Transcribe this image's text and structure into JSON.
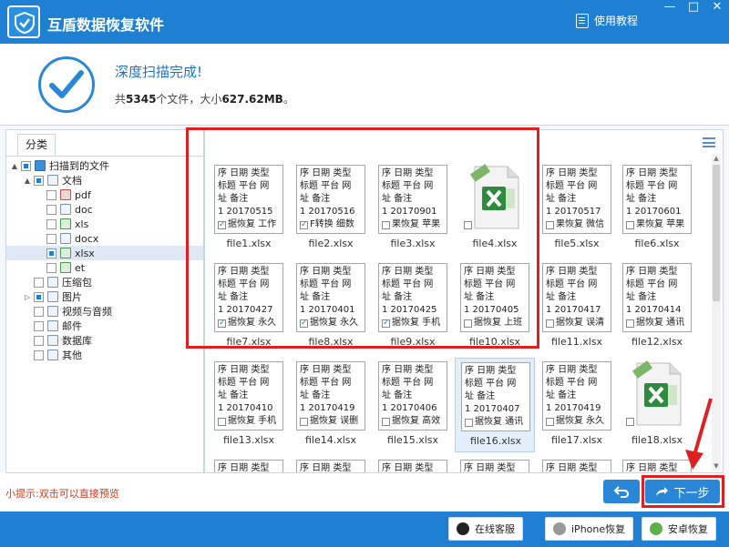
{
  "app": {
    "title": "互盾数据恢复软件",
    "tutorial_label": "使用教程",
    "window_buttons": [
      "—",
      "□",
      "✕"
    ]
  },
  "status": {
    "title": "深度扫描完成!",
    "prefix": "共",
    "file_count": "5345",
    "mid": "个文件，大小",
    "size": "627.62MB",
    "suffix": "。"
  },
  "left_panel": {
    "tab_label": "分类",
    "tree": [
      {
        "label": "扫描到的文件",
        "toggle": "▲",
        "icon": "folder",
        "check": "partial"
      },
      {
        "label": "文档",
        "toggle": "▲",
        "icon": "doc",
        "check": "partial"
      },
      {
        "label": "pdf",
        "toggle": "",
        "icon": "pdf",
        "check": "none"
      },
      {
        "label": "doc",
        "toggle": "",
        "icon": "doc",
        "check": "none"
      },
      {
        "label": "xls",
        "toggle": "",
        "icon": "xls",
        "check": "none"
      },
      {
        "label": "docx",
        "toggle": "",
        "icon": "doc",
        "check": "none"
      },
      {
        "label": "xlsx",
        "toggle": "",
        "icon": "xls",
        "check": "partial"
      },
      {
        "label": "et",
        "toggle": "",
        "icon": "xls",
        "check": "none"
      },
      {
        "label": "压缩包",
        "toggle": "",
        "icon": "doc",
        "check": "none"
      },
      {
        "label": "图片",
        "toggle": "▷",
        "icon": "doc",
        "check": "partial"
      },
      {
        "label": "视频与音频",
        "toggle": "",
        "icon": "doc",
        "check": "none"
      },
      {
        "label": "邮件",
        "toggle": "",
        "icon": "doc",
        "check": "none"
      },
      {
        "label": "数据库",
        "toggle": "",
        "icon": "doc",
        "check": "none"
      },
      {
        "label": "其他",
        "toggle": "",
        "icon": "doc",
        "check": "none"
      }
    ]
  },
  "thumb_header": [
    "序 日期 类型",
    "标题 平台 网",
    "址 备注"
  ],
  "files": [
    {
      "name": "file1.xlsx",
      "kind": "text",
      "date_line": "1 20170515",
      "last": "据恢复 工作",
      "checked": true
    },
    {
      "name": "file2.xlsx",
      "kind": "text",
      "date_line": "1 20170516",
      "last": "F转换 细数",
      "checked": true
    },
    {
      "name": "file3.xlsx",
      "kind": "text",
      "date_line": "1 20170901",
      "last": "果恢复 苹果",
      "checked": false
    },
    {
      "name": "file4.xlsx",
      "kind": "icon",
      "date_line": "",
      "last": "",
      "checked": false
    },
    {
      "name": "file5.xlsx",
      "kind": "text",
      "date_line": "1 20170517",
      "last": "果恢复 微信",
      "checked": false
    },
    {
      "name": "file6.xlsx",
      "kind": "text",
      "date_line": "1 20170601",
      "last": "果恢复 苹果",
      "checked": false
    },
    {
      "name": "file7.xlsx",
      "kind": "text",
      "date_line": "1 20170427",
      "last": "据恢复 永久",
      "checked": true
    },
    {
      "name": "file8.xlsx",
      "kind": "text",
      "date_line": "1 20170401",
      "last": "据恢复 永久",
      "checked": true
    },
    {
      "name": "file9.xlsx",
      "kind": "text",
      "date_line": "1 20170425",
      "last": "据恢复 手机",
      "checked": true
    },
    {
      "name": "file10.xlsx",
      "kind": "text",
      "date_line": "1 20170405",
      "last": "据恢复 上班",
      "checked": false
    },
    {
      "name": "file11.xlsx",
      "kind": "text",
      "date_line": "1 20170417",
      "last": "据恢复 误清",
      "checked": false
    },
    {
      "name": "file12.xlsx",
      "kind": "text",
      "date_line": "1 20170414",
      "last": "据恢复 通讯",
      "checked": false
    },
    {
      "name": "file13.xlsx",
      "kind": "text",
      "date_line": "1 20170410",
      "last": "据恢复 手机",
      "checked": false
    },
    {
      "name": "file14.xlsx",
      "kind": "text",
      "date_line": "1 20170419",
      "last": "据恢复 误删",
      "checked": false
    },
    {
      "name": "file15.xlsx",
      "kind": "text",
      "date_line": "1 20170406",
      "last": "据恢复 高效",
      "checked": false
    },
    {
      "name": "file16.xlsx",
      "kind": "text",
      "date_line": "1 20170407",
      "last": "据恢复 通讯",
      "checked": false
    },
    {
      "name": "file17.xlsx",
      "kind": "text",
      "date_line": "1 20170419",
      "last": "据恢复 永久",
      "checked": false
    },
    {
      "name": "file18.xlsx",
      "kind": "icon",
      "date_line": "",
      "last": "",
      "checked": false
    },
    {
      "name": "",
      "kind": "partial",
      "date_line": "",
      "last": "",
      "checked": false
    },
    {
      "name": "",
      "kind": "partial",
      "date_line": "",
      "last": "",
      "checked": false
    },
    {
      "name": "",
      "kind": "partial",
      "date_line": "",
      "last": "",
      "checked": false
    },
    {
      "name": "",
      "kind": "partial",
      "date_line": "",
      "last": "",
      "checked": false
    },
    {
      "name": "",
      "kind": "partial",
      "date_line": "",
      "last": "",
      "checked": false
    },
    {
      "name": "",
      "kind": "partial",
      "date_line": "",
      "last": "",
      "checked": false
    }
  ],
  "hint": "小提示:双击可以直接预览",
  "buttons": {
    "next": "下一步"
  },
  "footer": {
    "online_service": "在线客服",
    "iphone_recovery": "iPhone恢复",
    "android_recovery": "安卓恢复"
  },
  "colors": {
    "brand_blue": "#1e7fd3",
    "highlight_red": "#e02020",
    "hint_red": "#d6391f"
  }
}
